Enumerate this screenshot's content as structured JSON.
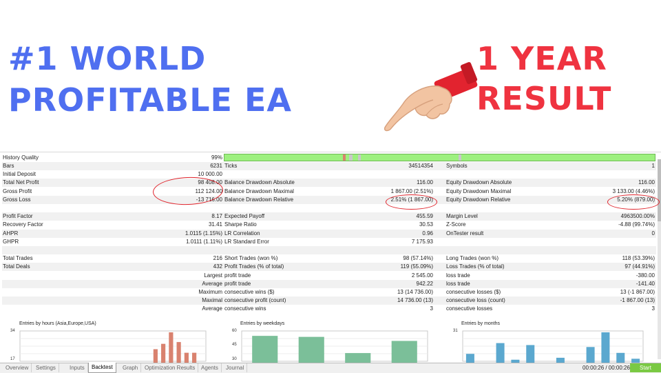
{
  "headline": {
    "left_line1": "#1 WORLD",
    "left_line2": "PROFITABLE EA",
    "right_line1": "1 YEAR",
    "right_line2": "RESULT"
  },
  "colors": {
    "headline_blue": "#4f6ff0",
    "headline_red": "#ef3340",
    "circle_red": "#e0222a",
    "bar_green": "#9df07f"
  },
  "icons": {
    "hand": "pointing-hand-icon"
  },
  "report": {
    "history_quality": {
      "label": "History Quality",
      "value": "99%"
    },
    "rows": [
      [
        "Bars",
        "6231",
        "Ticks",
        "34514354",
        "Symbols",
        "1"
      ],
      [
        "Initial Deposit",
        "10 000.00",
        "",
        "",
        "",
        ""
      ],
      [
        "Total Net Profit",
        "98 408.00",
        "Balance Drawdown Absolute",
        "116.00",
        "Equity Drawdown Absolute",
        "116.00"
      ],
      [
        "Gross Profit",
        "112 124.00",
        "Balance Drawdown Maximal",
        "1 867.00 (2.51%)",
        "Equity Drawdown Maximal",
        "3 133.00 (4.46%)"
      ],
      [
        "Gross Loss",
        "-13 716.00",
        "Balance Drawdown Relative",
        "2.51% (1 867.00)",
        "Equity Drawdown Relative",
        "5.20% (879.00)"
      ],
      [
        "",
        "",
        "",
        "",
        "",
        ""
      ],
      [
        "Profit Factor",
        "8.17",
        "Expected Payoff",
        "455.59",
        "Margin Level",
        "4963500.00%"
      ],
      [
        "Recovery Factor",
        "31.41",
        "Sharpe Ratio",
        "30.53",
        "Z-Score",
        "-4.88 (99.74%)"
      ],
      [
        "AHPR",
        "1.0115 (1.15%)",
        "LR Correlation",
        "0.96",
        "OnTester result",
        "0"
      ],
      [
        "GHPR",
        "1.0111 (1.11%)",
        "LR Standard Error",
        "7 175.93",
        "",
        ""
      ],
      [
        "",
        "",
        "",
        "",
        "",
        ""
      ],
      [
        "Total Trades",
        "216",
        "Short Trades (won %)",
        "98 (57.14%)",
        "Long Trades (won %)",
        "118 (53.39%)"
      ],
      [
        "Total Deals",
        "432",
        "Profit Trades (% of total)",
        "119 (55.09%)",
        "Loss Trades (% of total)",
        "97 (44.91%)"
      ],
      [
        "",
        "Largest",
        "profit trade",
        "2 545.00",
        "loss trade",
        "-380.00"
      ],
      [
        "",
        "Average",
        "profit trade",
        "942.22",
        "loss trade",
        "-141.40"
      ],
      [
        "",
        "Maximum",
        "consecutive wins ($)",
        "13 (14 736.00)",
        "consecutive losses ($)",
        "13 (-1 867.00)"
      ],
      [
        "",
        "Maximal",
        "consecutive profit (count)",
        "14 736.00 (13)",
        "consecutive loss (count)",
        "-1 867.00 (13)"
      ],
      [
        "",
        "Average",
        "consecutive wins",
        "3",
        "consecutive losses",
        "3"
      ]
    ]
  },
  "chart_data": [
    {
      "type": "bar",
      "title": "Entries by hours (Asia,Europe,USA)",
      "yticks": [
        "34",
        "17"
      ],
      "ylim": [
        17,
        34
      ],
      "values": [
        0,
        0,
        0,
        0,
        0,
        0,
        0,
        0,
        0,
        0,
        0,
        0,
        0,
        0,
        0,
        0,
        0,
        22,
        25,
        34,
        26,
        20,
        20,
        0
      ],
      "color": "#d9826f"
    },
    {
      "type": "bar",
      "title": "Entries by weekdays",
      "yticks": [
        "60",
        "45",
        "30"
      ],
      "ylim": [
        30,
        60
      ],
      "values": [
        52,
        51,
        35,
        47
      ],
      "color": "#7bbf99"
    },
    {
      "type": "bar",
      "title": "Entries by months",
      "yticks": [
        "31"
      ],
      "ylim": [
        0,
        31
      ],
      "values": [
        9,
        0,
        20,
        3,
        18,
        0,
        5,
        0,
        16,
        31,
        10,
        4
      ],
      "color": "#5ba8cf"
    }
  ],
  "tabs": [
    "Overview",
    "Settings",
    "Inputs",
    "Backtest",
    "Graph",
    "Optimization Results",
    "Agents",
    "Journal"
  ],
  "active_tab": "Backtest",
  "timer": "00:00:26 / 00:00:26",
  "start_label": "Start"
}
